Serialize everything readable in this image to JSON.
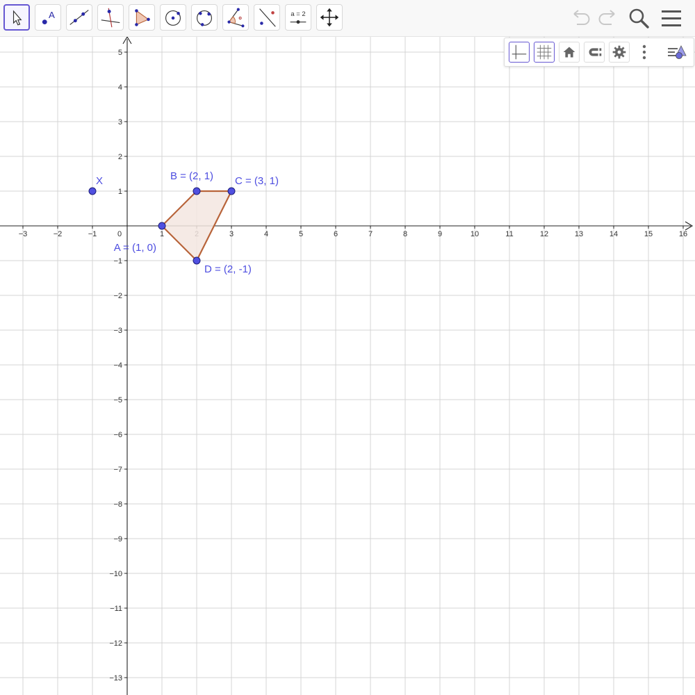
{
  "toolbar": {
    "tools": [
      {
        "name": "move-tool",
        "icon": "cursor-arrow-icon",
        "selected": true
      },
      {
        "name": "point-tool",
        "icon": "point-icon",
        "label": "A"
      },
      {
        "name": "line-tool",
        "icon": "line-through-points-icon"
      },
      {
        "name": "perpendicular-line-tool",
        "icon": "perpendicular-line-icon"
      },
      {
        "name": "polygon-tool",
        "icon": "polygon-icon"
      },
      {
        "name": "circle-center-point-tool",
        "icon": "circle-center-point-icon"
      },
      {
        "name": "circle-three-points-tool",
        "icon": "circle-three-points-icon"
      },
      {
        "name": "angle-tool",
        "icon": "angle-icon"
      },
      {
        "name": "reflect-tool",
        "icon": "reflect-about-line-icon"
      },
      {
        "name": "slider-tool",
        "icon": "slider-icon",
        "label": "a = 2"
      },
      {
        "name": "move-graphics-view-tool",
        "icon": "move-arrows-icon"
      }
    ],
    "right": [
      "undo-icon",
      "redo-icon",
      "search-icon",
      "menu-icon"
    ]
  },
  "style_bar": {
    "buttons": [
      "axes-icon",
      "grid-icon",
      "home-icon",
      "snap-icon",
      "gear-icon",
      "more-vertical-icon",
      "style-bar-toggle-icon"
    ]
  },
  "graphics": {
    "x_ticks": [
      "−3",
      "−2",
      "−1",
      "0",
      "1",
      "2",
      "3",
      "4",
      "5",
      "6",
      "7",
      "8",
      "9",
      "10",
      "11",
      "12",
      "13",
      "14",
      "15",
      "16"
    ],
    "y_ticks": [
      "5",
      "4",
      "3",
      "2",
      "1",
      "−1",
      "−2",
      "−3",
      "−4",
      "−5",
      "−6",
      "−7",
      "−8",
      "−9",
      "−10",
      "−11",
      "−12",
      "−13"
    ],
    "x_range": [
      -3.6,
      16.4
    ],
    "y_range": [
      -13.5,
      5.5
    ],
    "grid": true,
    "colors": {
      "point": "#5050e0",
      "polygon_stroke": "#b8643a",
      "polygon_fill": "#f3e6e0",
      "label": "#4d4de0"
    },
    "points": [
      {
        "id": "A",
        "x": 1,
        "y": 0,
        "label": "A = (1, 0)",
        "label_pos": "bottom-left"
      },
      {
        "id": "B",
        "x": 2,
        "y": 1,
        "label": "B = (2, 1)",
        "label_pos": "top"
      },
      {
        "id": "C",
        "x": 3,
        "y": 1,
        "label": "C = (3, 1)",
        "label_pos": "top-right"
      },
      {
        "id": "D",
        "x": 2,
        "y": -1,
        "label": "D = (2, -1)",
        "label_pos": "bottom-right"
      },
      {
        "id": "X",
        "x": -1,
        "y": 1,
        "label": "X",
        "label_pos": "top-right"
      }
    ],
    "polygon": [
      "A",
      "B",
      "C",
      "D"
    ]
  }
}
